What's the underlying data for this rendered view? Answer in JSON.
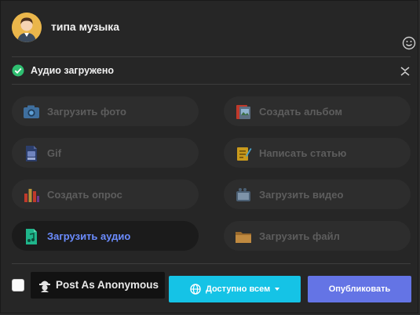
{
  "post": {
    "text": "типа музыка",
    "avatar_icon": "user-avatar",
    "emoji_icon": "smiley-icon"
  },
  "status": {
    "label": "Аудио загружено",
    "icon": "check-circle-icon",
    "collapse_icon": "collapse-icon"
  },
  "options": [
    {
      "label": "Загрузить фото",
      "icon": "camera-icon",
      "active": false
    },
    {
      "label": "Создать альбом",
      "icon": "photo-album-icon",
      "active": false
    },
    {
      "label": "Gif",
      "icon": "gif-file-icon",
      "active": false
    },
    {
      "label": "Написать статью",
      "icon": "article-icon",
      "active": false
    },
    {
      "label": "Создать опрос",
      "icon": "poll-icon",
      "active": false
    },
    {
      "label": "Загрузить видео",
      "icon": "video-icon",
      "active": false
    },
    {
      "label": "Загрузить аудио",
      "icon": "audio-file-icon",
      "active": true
    },
    {
      "label": "Загрузить файл",
      "icon": "folder-icon",
      "active": false
    }
  ],
  "footer": {
    "anonymous_label": "Post As Anonymous",
    "anonymous_checked": false,
    "privacy_label": "Доступно всем",
    "publish_label": "Опубликовать"
  },
  "colors": {
    "background": "#262626",
    "option_bg": "#2d2d2d",
    "active_option_bg": "#1b1b1b",
    "active_text": "#6b8cff",
    "privacy_button": "#15c3e6",
    "publish_button": "#6474e5",
    "check_green": "#2fbf71"
  }
}
